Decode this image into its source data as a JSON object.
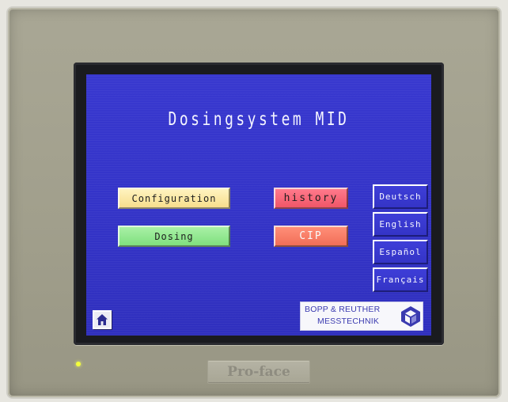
{
  "screen": {
    "title": "Dosingsystem MID"
  },
  "buttons": {
    "configuration": "Configuration",
    "dosing": "Dosing",
    "history": "history",
    "cip": "CIP"
  },
  "languages": [
    "Deutsch",
    "English",
    "Español",
    "Français"
  ],
  "logo": {
    "line1": "BOPP & REUTHER",
    "line2": "MESSTECHNIK"
  },
  "device": {
    "brand": "Pro-face"
  },
  "colors": {
    "screen_background": "#3434c8",
    "config_button": "#f7de8c",
    "dosing_button": "#7fe07e",
    "history_button": "#f05668",
    "cip_button": "#f26e58",
    "indicator_led": "#f4ff3a"
  },
  "icons": {
    "home": "home-icon",
    "logo": "bopp-reuther-logo-icon"
  }
}
